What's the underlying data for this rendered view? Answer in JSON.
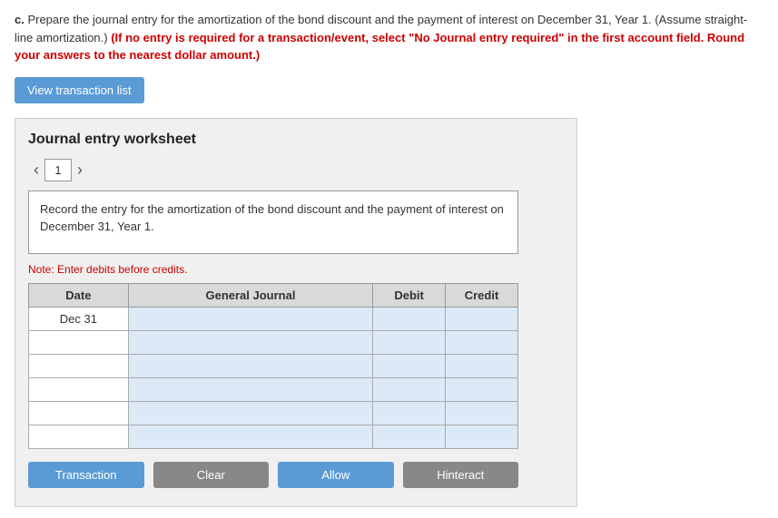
{
  "instructions": {
    "prefix": "c.",
    "text": " Prepare the journal entry for the amortization of the bond discount and the payment of interest on December 31, Year 1. (Assume straight-line amortization.) ",
    "bold_red": "(If no entry is required for a transaction/event, select \"No Journal entry required\" in the first account field. Round your answers to the nearest dollar amount.)"
  },
  "buttons": {
    "view_transaction": "View transaction list",
    "bottom": [
      "Transaction",
      "Clear",
      "Allow",
      "Hinteract"
    ]
  },
  "worksheet": {
    "title": "Journal entry worksheet",
    "tab_number": "1",
    "description": "Record the entry for the amortization of the bond discount and the payment of interest on December 31, Year 1.",
    "note": "Note: Enter debits before credits.",
    "table": {
      "headers": [
        "Date",
        "General Journal",
        "Debit",
        "Credit"
      ],
      "rows": [
        {
          "date": "Dec 31",
          "general": "",
          "debit": "",
          "credit": ""
        },
        {
          "date": "",
          "general": "",
          "debit": "",
          "credit": ""
        },
        {
          "date": "",
          "general": "",
          "debit": "",
          "credit": ""
        },
        {
          "date": "",
          "general": "",
          "debit": "",
          "credit": ""
        },
        {
          "date": "",
          "general": "",
          "debit": "",
          "credit": ""
        },
        {
          "date": "",
          "general": "",
          "debit": "",
          "credit": ""
        }
      ]
    }
  }
}
